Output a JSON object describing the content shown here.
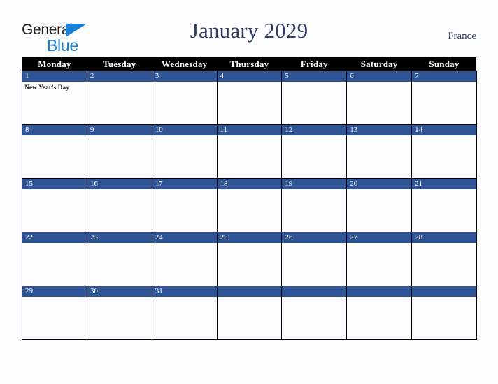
{
  "brand": {
    "logo_text_top": "General",
    "logo_text_bottom": "Blue",
    "logo_triangle_icon": "triangle-icon",
    "accent_blue": "#1b7fd4"
  },
  "header": {
    "title": "January 2029",
    "country": "France",
    "title_color": "#2b3f69"
  },
  "calendar": {
    "month": "January",
    "year": "2029",
    "header_bg": "#000000",
    "date_band_color": "#2e5496",
    "weekday_headers": [
      "Monday",
      "Tuesday",
      "Wednesday",
      "Thursday",
      "Friday",
      "Saturday",
      "Sunday"
    ],
    "weeks": [
      [
        {
          "date": "1",
          "events": [
            "New Year's Day"
          ]
        },
        {
          "date": "2",
          "events": []
        },
        {
          "date": "3",
          "events": []
        },
        {
          "date": "4",
          "events": []
        },
        {
          "date": "5",
          "events": []
        },
        {
          "date": "6",
          "events": []
        },
        {
          "date": "7",
          "events": []
        }
      ],
      [
        {
          "date": "8",
          "events": []
        },
        {
          "date": "9",
          "events": []
        },
        {
          "date": "10",
          "events": []
        },
        {
          "date": "11",
          "events": []
        },
        {
          "date": "12",
          "events": []
        },
        {
          "date": "13",
          "events": []
        },
        {
          "date": "14",
          "events": []
        }
      ],
      [
        {
          "date": "15",
          "events": []
        },
        {
          "date": "16",
          "events": []
        },
        {
          "date": "17",
          "events": []
        },
        {
          "date": "18",
          "events": []
        },
        {
          "date": "19",
          "events": []
        },
        {
          "date": "20",
          "events": []
        },
        {
          "date": "21",
          "events": []
        }
      ],
      [
        {
          "date": "22",
          "events": []
        },
        {
          "date": "23",
          "events": []
        },
        {
          "date": "24",
          "events": []
        },
        {
          "date": "25",
          "events": []
        },
        {
          "date": "26",
          "events": []
        },
        {
          "date": "27",
          "events": []
        },
        {
          "date": "28",
          "events": []
        }
      ],
      [
        {
          "date": "29",
          "events": []
        },
        {
          "date": "30",
          "events": []
        },
        {
          "date": "31",
          "events": []
        },
        {
          "date": "",
          "events": []
        },
        {
          "date": "",
          "events": []
        },
        {
          "date": "",
          "events": []
        },
        {
          "date": "",
          "events": []
        }
      ]
    ]
  }
}
